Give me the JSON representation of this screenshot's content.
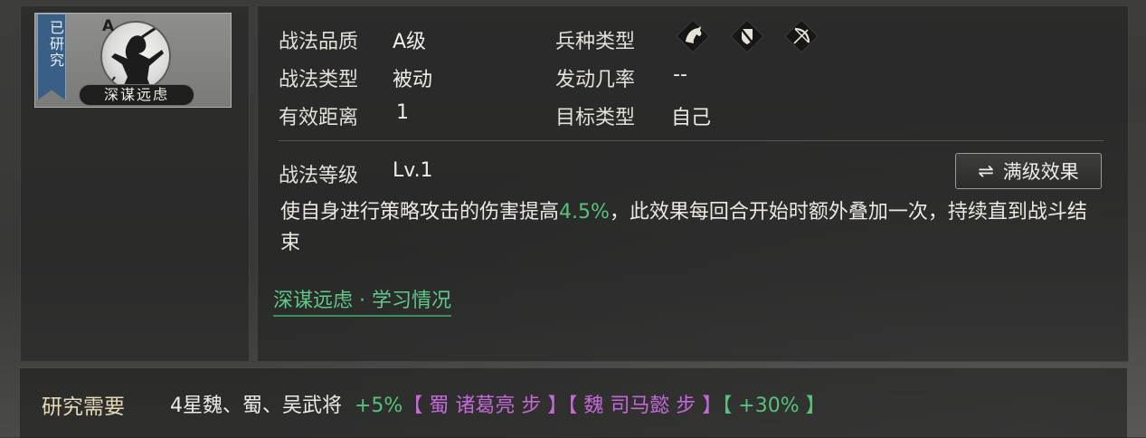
{
  "card": {
    "status_text": "已研究",
    "grade": "A",
    "skill_name": "深谋远虑"
  },
  "info": {
    "quality_label": "战法品质",
    "quality_value": "A级",
    "type_label": "战法类型",
    "type_value": "被动",
    "range_label": "有效距离",
    "range_value": "1",
    "troop_label": "兵种类型",
    "troop_icons": [
      "cavalry-icon",
      "shield-icon",
      "bow-icon"
    ],
    "rate_label": "发动几率",
    "rate_value": "--",
    "target_label": "目标类型",
    "target_value": "自己"
  },
  "level": {
    "label": "战法等级",
    "value": "Lv.1",
    "max_button_icon": "⇌",
    "max_button_label": "满级效果"
  },
  "description": {
    "before": "使自身进行策略攻击的伤害提高",
    "highlight": "4.5%",
    "after": "，此效果每回合开始时额外叠加一次，持续直到战斗结束"
  },
  "learn_link": "深谋远虑 · 学习情况",
  "requirement": {
    "label": "研究需要",
    "text": "4星魏、蜀、吴武将",
    "bonus1": "+5%",
    "general1": "【 蜀 诸葛亮 步 】",
    "general2": "【 魏 司马懿 步 】",
    "bonus2": "【 +30% 】"
  },
  "colors": {
    "accent_green": "#57c27e",
    "general_purple": "#c469d8",
    "ribbon_blue": "#3a5f86"
  }
}
